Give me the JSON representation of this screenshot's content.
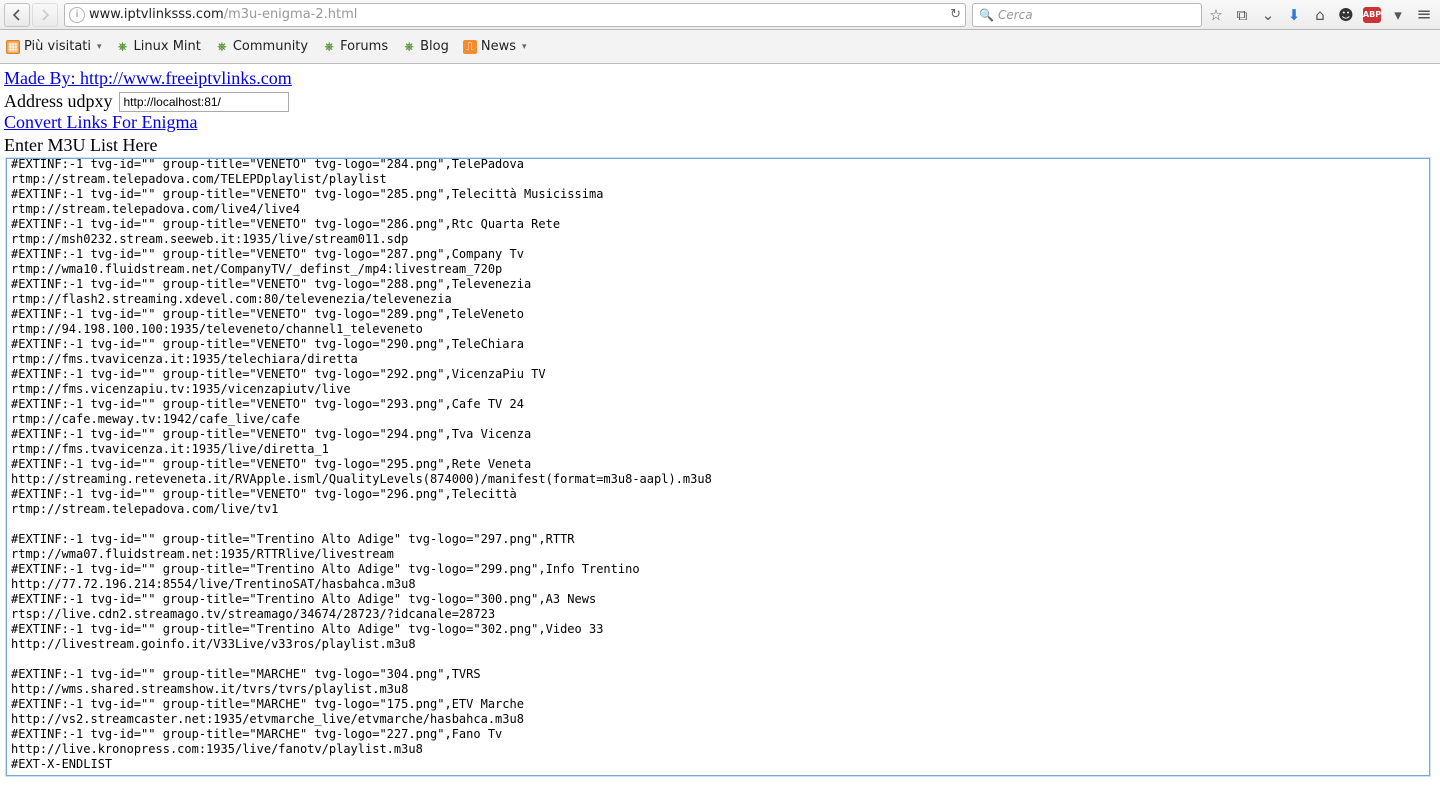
{
  "browser": {
    "url_prefix": "www.iptvlinksss.com",
    "url_suffix": "/m3u-enigma-2.html",
    "search_placeholder": "Cerca",
    "abp_label": "ABP"
  },
  "bookmarks": {
    "items": [
      {
        "label": "Più visitati",
        "has_dropdown": true,
        "icon": "orange"
      },
      {
        "label": "Linux Mint",
        "has_dropdown": false,
        "icon": "green"
      },
      {
        "label": "Community",
        "has_dropdown": false,
        "icon": "green"
      },
      {
        "label": "Forums",
        "has_dropdown": false,
        "icon": "green"
      },
      {
        "label": "Blog",
        "has_dropdown": false,
        "icon": "green"
      },
      {
        "label": "News",
        "has_dropdown": true,
        "icon": "rss"
      }
    ]
  },
  "page": {
    "made_by": "Made By: http://www.freeiptvlinks.com",
    "address_label": "Address udpxy",
    "address_value": "http://localhost:81/",
    "convert_link": "Convert Links For Enigma",
    "enter_label": "Enter M3U List Here",
    "m3u_text": "#EXTINF:-1 tvg-id=\"\" group-title=\"VENETO\" tvg-logo=\"284.png\",TelePadova\nrtmp://stream.telepadova.com/TELEPDplaylist/playlist\n#EXTINF:-1 tvg-id=\"\" group-title=\"VENETO\" tvg-logo=\"285.png\",Telecittà Musicissima\nrtmp://stream.telepadova.com/live4/live4\n#EXTINF:-1 tvg-id=\"\" group-title=\"VENETO\" tvg-logo=\"286.png\",Rtc Quarta Rete\nrtmp://msh0232.stream.seeweb.it:1935/live/stream011.sdp\n#EXTINF:-1 tvg-id=\"\" group-title=\"VENETO\" tvg-logo=\"287.png\",Company Tv\nrtmp://wma10.fluidstream.net/CompanyTV/_definst_/mp4:livestream_720p\n#EXTINF:-1 tvg-id=\"\" group-title=\"VENETO\" tvg-logo=\"288.png\",Televenezia\nrtmp://flash2.streaming.xdevel.com:80/televenezia/televenezia\n#EXTINF:-1 tvg-id=\"\" group-title=\"VENETO\" tvg-logo=\"289.png\",TeleVeneto\nrtmp://94.198.100.100:1935/televeneto/channel1_televeneto\n#EXTINF:-1 tvg-id=\"\" group-title=\"VENETO\" tvg-logo=\"290.png\",TeleChiara\nrtmp://fms.tvavicenza.it:1935/telechiara/diretta\n#EXTINF:-1 tvg-id=\"\" group-title=\"VENETO\" tvg-logo=\"292.png\",VicenzaPiu TV\nrtmp://fms.vicenzapiu.tv:1935/vicenzapiutv/live\n#EXTINF:-1 tvg-id=\"\" group-title=\"VENETO\" tvg-logo=\"293.png\",Cafe TV 24\nrtmp://cafe.meway.tv:1942/cafe_live/cafe\n#EXTINF:-1 tvg-id=\"\" group-title=\"VENETO\" tvg-logo=\"294.png\",Tva Vicenza\nrtmp://fms.tvavicenza.it:1935/live/diretta_1\n#EXTINF:-1 tvg-id=\"\" group-title=\"VENETO\" tvg-logo=\"295.png\",Rete Veneta\nhttp://streaming.reteveneta.it/RVApple.isml/QualityLevels(874000)/manifest(format=m3u8-aapl).m3u8\n#EXTINF:-1 tvg-id=\"\" group-title=\"VENETO\" tvg-logo=\"296.png\",Telecittà\nrtmp://stream.telepadova.com/live/tv1\n\n#EXTINF:-1 tvg-id=\"\" group-title=\"Trentino Alto Adige\" tvg-logo=\"297.png\",RTTR\nrtmp://wma07.fluidstream.net:1935/RTTRlive/livestream\n#EXTINF:-1 tvg-id=\"\" group-title=\"Trentino Alto Adige\" tvg-logo=\"299.png\",Info Trentino\nhttp://77.72.196.214:8554/live/TrentinoSAT/hasbahca.m3u8\n#EXTINF:-1 tvg-id=\"\" group-title=\"Trentino Alto Adige\" tvg-logo=\"300.png\",A3 News\nrtsp://live.cdn2.streamago.tv/streamago/34674/28723/?idcanale=28723\n#EXTINF:-1 tvg-id=\"\" group-title=\"Trentino Alto Adige\" tvg-logo=\"302.png\",Video 33\nhttp://livestream.goinfo.it/V33Live/v33ros/playlist.m3u8\n\n#EXTINF:-1 tvg-id=\"\" group-title=\"MARCHE\" tvg-logo=\"304.png\",TVRS\nhttp://wms.shared.streamshow.it/tvrs/tvrs/playlist.m3u8\n#EXTINF:-1 tvg-id=\"\" group-title=\"MARCHE\" tvg-logo=\"175.png\",ETV Marche\nhttp://vs2.streamcaster.net:1935/etvmarche_live/etvmarche/hasbahca.m3u8\n#EXTINF:-1 tvg-id=\"\" group-title=\"MARCHE\" tvg-logo=\"227.png\",Fano Tv\nhttp://live.kronopress.com:1935/live/fanotv/playlist.m3u8\n#EXT-X-ENDLIST"
  }
}
